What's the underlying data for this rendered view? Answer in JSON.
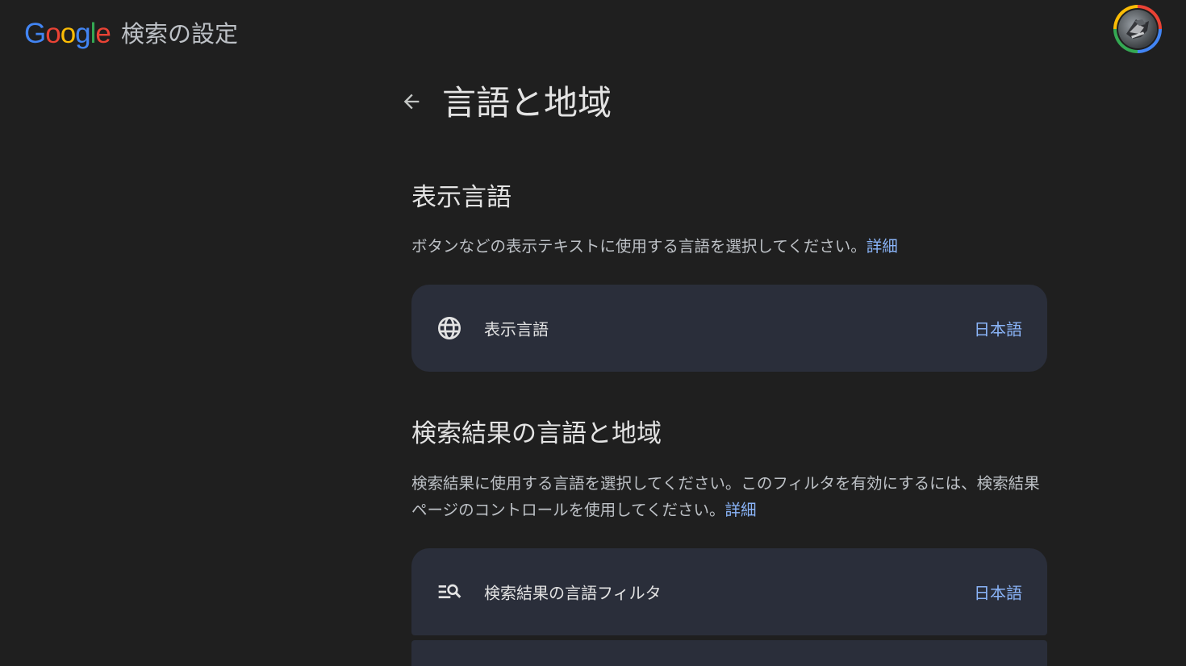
{
  "header": {
    "logo_letters": [
      "G",
      "o",
      "o",
      "g",
      "l",
      "e"
    ],
    "title": "検索の設定",
    "avatar_name": "account-avatar"
  },
  "page": {
    "title": "言語と地域",
    "back_icon": "arrow-back-icon"
  },
  "display_language": {
    "heading": "表示言語",
    "description": "ボタンなどの表示テキストに使用する言語を選択してください。",
    "learn_more": "詳細",
    "card": {
      "icon": "globe-icon",
      "label": "表示言語",
      "value": "日本語"
    }
  },
  "search_results": {
    "heading": "検索結果の言語と地域",
    "description": "検索結果に使用する言語を選択してください。このフィルタを有効にするには、検索結果ページのコントロールを使用してください。",
    "learn_more": "詳細",
    "card": {
      "icon": "search-filter-icon",
      "label": "検索結果の言語フィルタ",
      "value": "日本語"
    }
  },
  "colors": {
    "background": "#1f1f1f",
    "card": "#2a2e3a",
    "link": "#8ab4f8",
    "text": "#e3e3e3",
    "secondary_text": "#bdc1c6"
  }
}
